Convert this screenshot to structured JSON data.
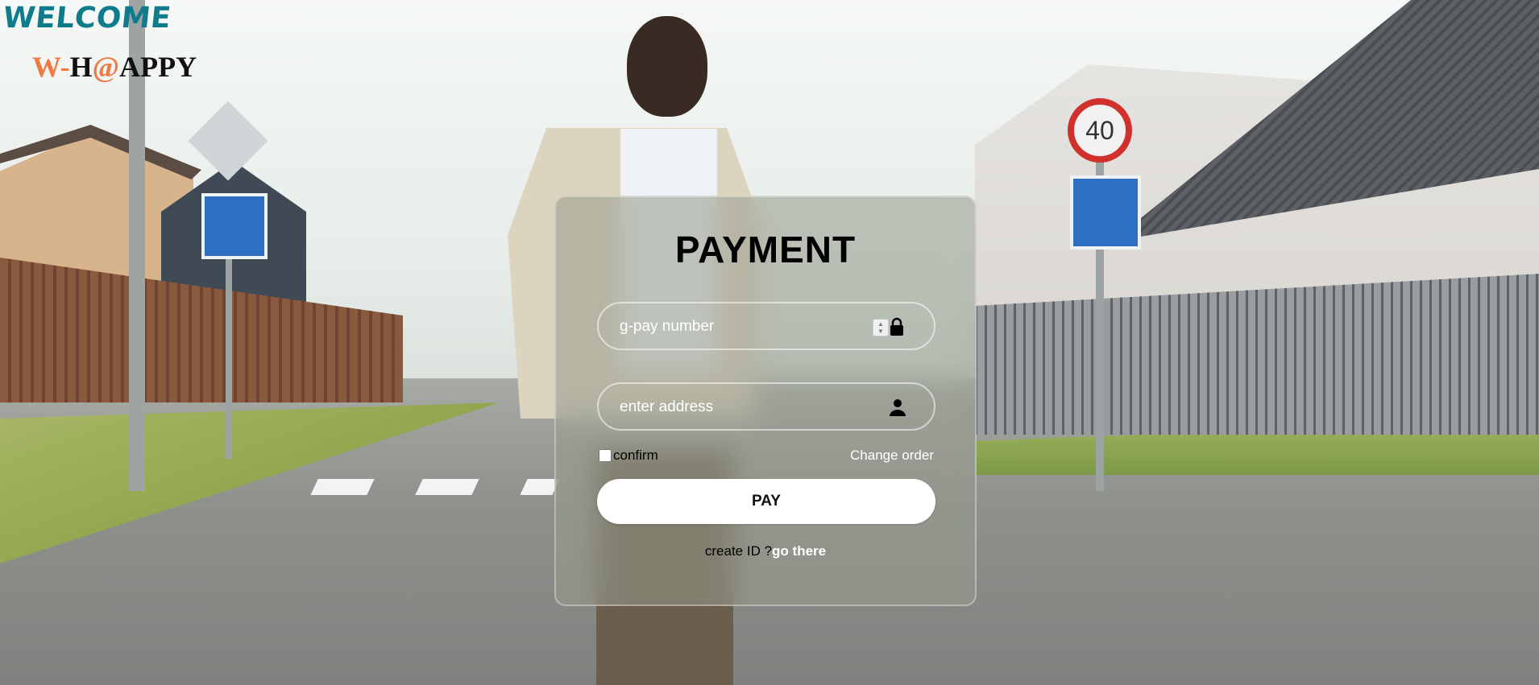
{
  "brand": {
    "welcome": "WELCOME",
    "logo_w": "W-",
    "logo_h": "H",
    "logo_at": "@",
    "logo_rest": "APPY"
  },
  "background": {
    "speed_sign": "40"
  },
  "payment_form": {
    "title": "PAYMENT",
    "gpay_field": {
      "placeholder": "g-pay number",
      "value": "",
      "icon": "lock-icon"
    },
    "address_field": {
      "placeholder": "enter address",
      "value": "",
      "icon": "user-icon"
    },
    "confirm_label": "confirm",
    "confirm_checked": false,
    "change_order_label": "Change order",
    "pay_button_label": "PAY",
    "create_id_text": "create ID ?",
    "go_there_link": "go there"
  },
  "colors": {
    "brand_teal": "#0f7c8c",
    "brand_orange": "#f07a45",
    "button_bg": "#ffffff"
  }
}
